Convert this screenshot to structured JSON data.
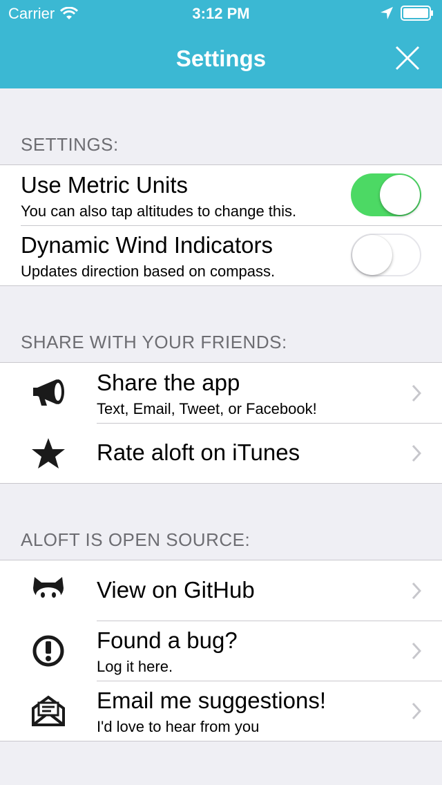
{
  "status_bar": {
    "carrier": "Carrier",
    "time": "3:12 PM"
  },
  "nav": {
    "title": "Settings"
  },
  "settings_section": {
    "header": "SETTINGS:",
    "items": [
      {
        "title": "Use Metric Units",
        "subtitle": "You can also tap altitudes to change this.",
        "toggle": true
      },
      {
        "title": "Dynamic Wind Indicators",
        "subtitle": "Updates direction based on compass.",
        "toggle": false
      }
    ]
  },
  "share_section": {
    "header": "SHARE WITH YOUR FRIENDS:",
    "items": [
      {
        "title": "Share the app",
        "subtitle": "Text, Email, Tweet, or Facebook!",
        "icon": "megaphone-icon"
      },
      {
        "title": "Rate aloft on iTunes",
        "icon": "star-icon"
      }
    ]
  },
  "source_section": {
    "header": "ALOFT IS OPEN SOURCE:",
    "items": [
      {
        "title": "View on GitHub",
        "icon": "github-octocat-icon"
      },
      {
        "title": "Found a bug?",
        "subtitle": "Log it here.",
        "icon": "alert-icon"
      },
      {
        "title": "Email me suggestions!",
        "subtitle": "I'd love to hear from you",
        "icon": "envelope-icon"
      }
    ]
  },
  "colors": {
    "accent": "#3bb8d3",
    "toggle_on": "#4cd964",
    "background": "#efeff4"
  }
}
